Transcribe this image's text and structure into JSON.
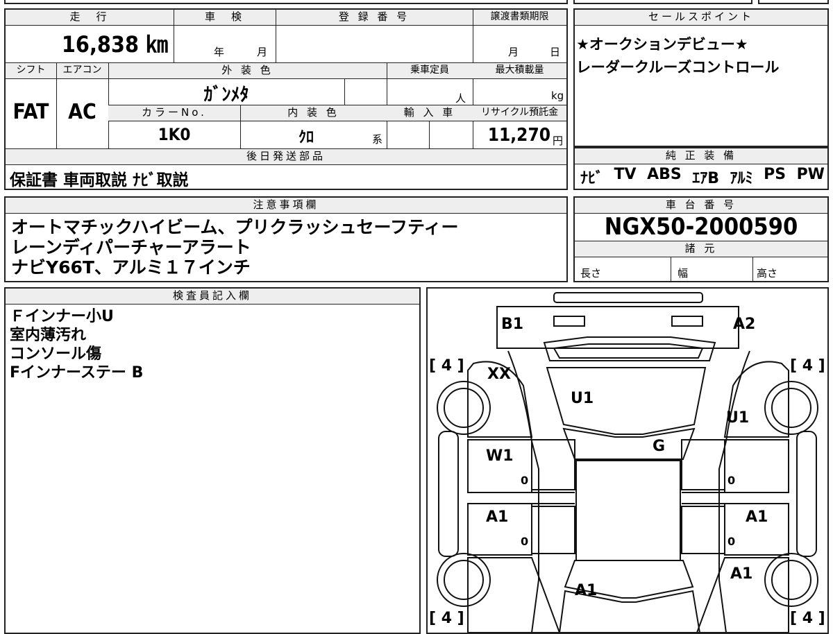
{
  "top": {
    "mileage_label": "走　行",
    "mileage_value": "16,838 ㎞",
    "shaken_label": "車　検",
    "shaken_year": "年",
    "shaken_month": "月",
    "reg_label": "登 録 番 号",
    "transfer_label": "譲渡書類期限",
    "transfer_month": "月",
    "transfer_day": "日"
  },
  "sales_point": {
    "label": "セールスポイント",
    "lines": [
      "★オークションデビュー★",
      "レーダークルーズコントロール"
    ]
  },
  "specs": {
    "shift_label": "シフト",
    "shift_value": "FAT",
    "ac_label": "エアコン",
    "ac_value": "AC",
    "exterior_label": "外 装 色",
    "exterior_value": "ｶﾞﾝﾒﾀ",
    "capacity_label": "乗車定員",
    "capacity_unit": "人",
    "maxload_label": "最大積載量",
    "maxload_unit": "kg",
    "color_no_label": "カラーNo.",
    "color_no_value": "1K0",
    "interior_label": "内 装 色",
    "interior_value": "ｸﾛ",
    "interior_suffix": "系",
    "import_label": "輸 入 車",
    "recycle_label": "リサイクル預託金",
    "recycle_value": "11,270",
    "recycle_unit": "円"
  },
  "later_parts": {
    "label": "後日発送部品",
    "value": "保証書 車両取説 ﾅﾋﾞ取説"
  },
  "equipment": {
    "label": "純 正 装 備",
    "items": [
      "ﾅﾋﾞ",
      "TV",
      "ABS",
      "ｴｱB",
      "ｱﾙﾐ",
      "PS",
      "PW"
    ]
  },
  "notes": {
    "label": "注意事項欄",
    "lines": [
      "オートマチックハイビーム、プリクラッシュセーフティー",
      "レーンディパーチャーアラート",
      "ナビY66T、アルミ１７インチ"
    ]
  },
  "chassis": {
    "label": "車 台 番 号",
    "value": "NGX50-2000590",
    "dims_label": "諸 元",
    "length_label": "長さ",
    "width_label": "幅",
    "height_label": "高さ"
  },
  "inspector": {
    "label": "検査員記入欄",
    "lines": [
      "Ｆインナー小U",
      "室内薄汚れ",
      "コンソール傷",
      "Fインナーステー B"
    ]
  },
  "diagram": {
    "tyre_fl": "[ 4 ]",
    "tyre_fr": "[ 4 ]",
    "tyre_rl": "[ 4 ]",
    "tyre_rr": "[ 4 ]",
    "mark_b1": "B1",
    "mark_a2": "A2",
    "mark_xx": "XX",
    "mark_hood": "U1",
    "mark_right_fender": "U1",
    "mark_roof": "G",
    "mark_left_front_door": "W1",
    "mark_left_rear_door": "A1",
    "mark_right_rear_door": "A1",
    "mark_right_rear": "A1",
    "mark_trunk": "A1",
    "zero_lf": "0",
    "zero_lr": "0",
    "zero_rf": "0",
    "zero_rr": "0"
  }
}
